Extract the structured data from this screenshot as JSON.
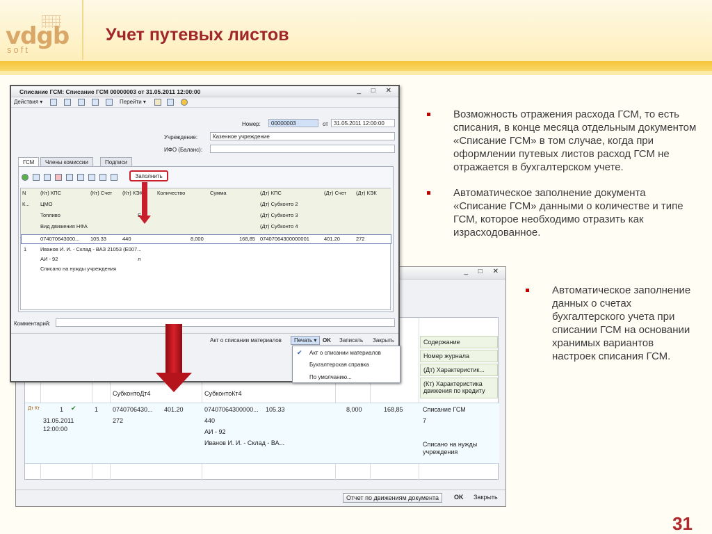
{
  "slide": {
    "title": "Учет путевых листов",
    "logo_text": "vdgb",
    "logo_sub": "soft",
    "page_number": "31"
  },
  "bullets_top": [
    "Возможность отражения расхода ГСМ, то есть списания, в конце месяца отдельным документом «Списание ГСМ» в том случае, когда при оформлении путевых листов расход ГСМ не отражается в бухгалтерском учете.",
    "Автоматическое заполнение документа «Списание ГСМ» данными о количестве и типе ГСМ, которое необходимо отразить как израсходованное."
  ],
  "bullets_bottom": [
    "Автоматическое заполнение данных о счетах бухгалтерского учета при списании ГСМ на основании хранимых вариантов настроек списания ГСМ."
  ],
  "front_window": {
    "title": "Списание ГСМ: Списание ГСМ 00000003 от 31.05.2011 12:00:00",
    "controls": "_ □ ✕",
    "toolbar": {
      "actions": "Действия ▾",
      "goto": "Перейти ▾"
    },
    "number_label": "Номер:",
    "number_value": "00000003",
    "date_label": "от",
    "date_value": "31.05.2011 12:00:00",
    "org_label": "Учреждение:",
    "org_value": "Казенное учреждение",
    "ifo_label": "ИФО (Баланс):",
    "ifo_value": "",
    "tabs": [
      "ГСМ",
      "Члены комиссии",
      "Подписи"
    ],
    "fill_button": "Заполнить",
    "grid": {
      "h_n": "N",
      "h_k": "К...",
      "h_kps": "(Кт) КПС",
      "h_acc": "(Кт) Счет",
      "h_kek": "(Кт) КЭК",
      "h_cmo": "ЦМО",
      "h_fuel": "Топливо",
      "h_ed": "Ед.",
      "h_nfa": "Вид движения НФА",
      "h_qty": "Количество",
      "h_sum": "Сумма",
      "h_dkps": "(Дт) КПС",
      "h_dacc": "(Дт) Счет",
      "h_dkek": "(Дт) КЭК",
      "h_s2": "(Дт) Субконто 2",
      "h_s3": "(Дт) Субконто 3",
      "h_s4": "(Дт) Субконто 4",
      "r_kps": "074070643000...",
      "r_acc": "105.33",
      "r_kek": "440",
      "r_qty": "8,000",
      "r_sum": "168,85",
      "r_dkps": "07407064300000001",
      "r_dacc": "401.20",
      "r_dkek": "272",
      "r_n": "1",
      "r_cmo": "Иванов И. И. - Склад - ВАЗ 21053 (Е007...",
      "r_fuel": "АИ - 92",
      "r_ed": "л",
      "r_nfa": "Списано на нужды учреждения"
    },
    "comment_label": "Комментарий:",
    "footer": {
      "act": "Акт о списании материалов",
      "print": "Печать ▾",
      "ok": "OK",
      "save": "Записать",
      "close": "Закрыть"
    },
    "print_menu": [
      "Акт о списании материалов",
      "Бухгалтерская справка",
      "По умолчанию..."
    ]
  },
  "back_window": {
    "controls": "_ □ ✕",
    "header_cells": [
      "Содержание",
      "Номер журнала",
      "(Дт) Характеристик...",
      "(Кт) Характеристика движения по кредиту"
    ],
    "col_labels": {
      "dt4": "СубконтоДт4",
      "kt4": "СубконтоКт4"
    },
    "row": {
      "icon": "Дт Кт",
      "num": "1",
      "date": "31.05.2011",
      "time": "12:00:00",
      "n": "1",
      "dt_code": "0740706430...",
      "dt_acc": "401.20",
      "dt_kek": "272",
      "kt_code": "07407064300000...",
      "kt_acc": "105.33",
      "kt_kek": "440",
      "kt_fuel": "АИ - 92",
      "kt_store": "Иванов И. И. - Склад - ВА...",
      "qty": "8,000",
      "sum": "168,85",
      "content": "Списание ГСМ",
      "journal": "7",
      "char": "Списано на нужды учреждения"
    },
    "footer": {
      "report": "Отчет по движениям документа",
      "ok": "OK",
      "close": "Закрыть"
    }
  }
}
